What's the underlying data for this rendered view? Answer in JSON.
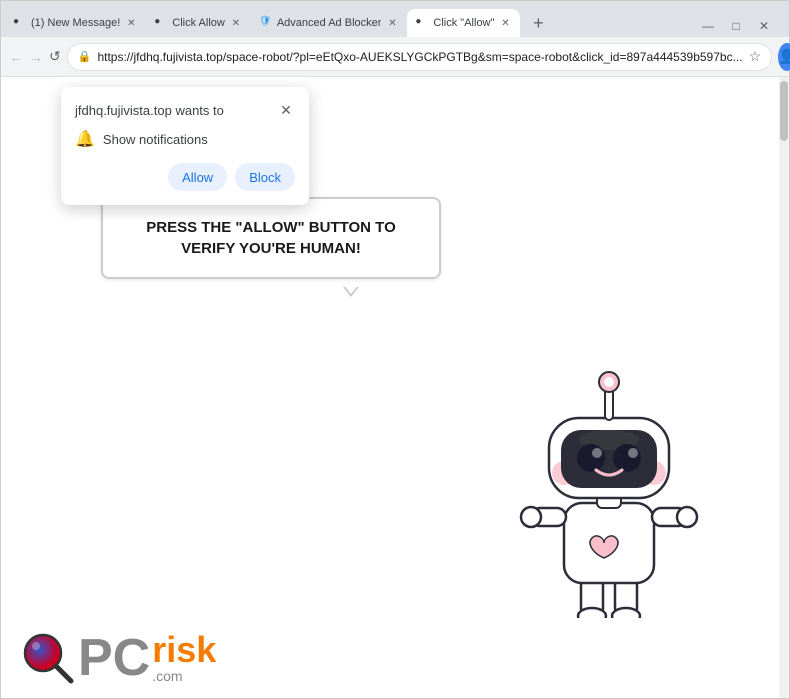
{
  "browser": {
    "tabs": [
      {
        "id": "tab1",
        "label": "(1) New Message!",
        "active": false,
        "favicon": "●"
      },
      {
        "id": "tab2",
        "label": "Click Allow",
        "active": false,
        "favicon": "●"
      },
      {
        "id": "tab3",
        "label": "Advanced Ad Blocker",
        "active": false,
        "favicon": "🛡"
      },
      {
        "id": "tab4",
        "label": "Click \"Allow\"",
        "active": true,
        "favicon": "●"
      }
    ],
    "url": "https://jfdhq.fujivista.top/space-robot/?pl=eEtQxo-AUEKSLYGCkPGTBg&sm=space-robot&click_id=897a444539b597bc...",
    "new_tab_label": "+",
    "window_controls": [
      "—",
      "□",
      "✕"
    ]
  },
  "nav": {
    "back_label": "←",
    "forward_label": "→",
    "reload_label": "↺"
  },
  "notification_popup": {
    "title": "jfdhq.fujivista.top wants to",
    "close_label": "✕",
    "notification_text": "Show notifications",
    "allow_label": "Allow",
    "block_label": "Block"
  },
  "page": {
    "speech_text": "PRESS THE \"ALLOW\" BUTTON TO VERIFY YOU'RE HUMAN!",
    "logo": {
      "pc_text": "PC",
      "risk_text": "risk",
      "com_text": ".com"
    }
  },
  "colors": {
    "allow_bg": "#e8f0fe",
    "allow_text": "#1a73e8",
    "block_bg": "#e8f0fe",
    "block_text": "#1a73e8",
    "accent_orange": "#f47c00",
    "robot_pink": "#f9c0cb",
    "robot_dark": "#2d2d3a"
  }
}
